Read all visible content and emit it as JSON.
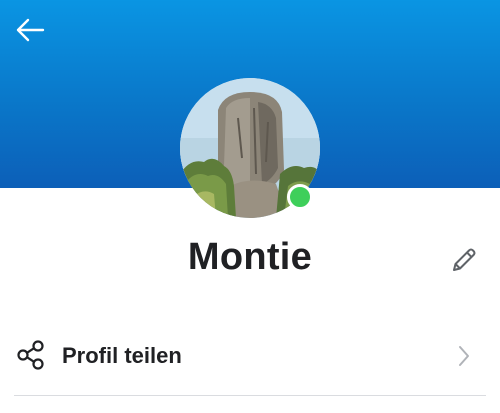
{
  "header": {
    "back_icon": "arrow-left-icon",
    "background_color": "#0a77c9"
  },
  "profile": {
    "name": "Montie",
    "status_color": "#3ecf5a",
    "edit_icon": "pencil-icon"
  },
  "menu": {
    "items": [
      {
        "label": "Profil teilen",
        "icon": "share-icon",
        "trailing_icon": "chevron-right-icon"
      }
    ]
  }
}
